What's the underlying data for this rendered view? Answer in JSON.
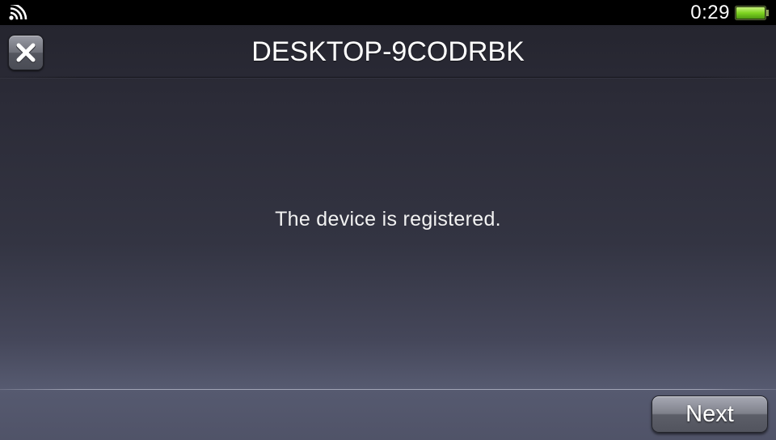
{
  "status_bar": {
    "time": "0:29",
    "signal_icon": "wifi-signal-icon",
    "battery_icon": "battery-full-icon",
    "battery_level": 1.0,
    "battery_color": "#7ed321"
  },
  "header": {
    "title": "DESKTOP-9CODRBK",
    "close_icon": "close-icon"
  },
  "content": {
    "message": "The device is registered."
  },
  "footer": {
    "next_label": "Next"
  },
  "colors": {
    "background_top": "#23232c",
    "background_bottom": "#565a70",
    "text": "#ffffff"
  }
}
